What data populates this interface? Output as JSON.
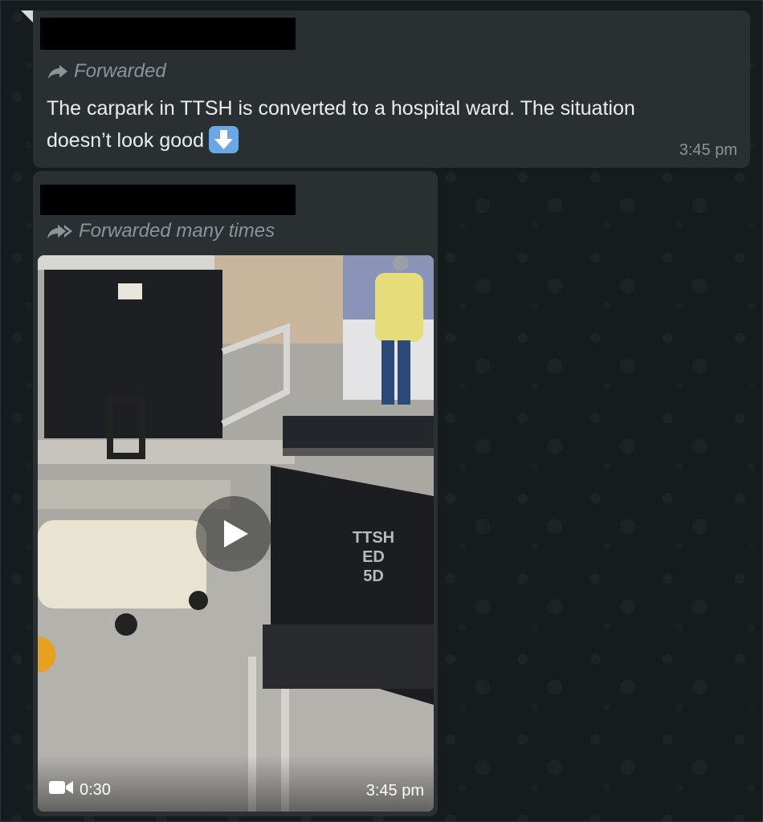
{
  "messages": [
    {
      "forward_label": "Forwarded",
      "text": "The carpark in TTSH is converted to a hospital ward. The situation doesn’t look good",
      "emoji": "down-arrow-emoji",
      "time": "3:45 pm"
    },
    {
      "forward_label": "Forwarded many times",
      "video": {
        "duration": "0:30",
        "time": "3:45 pm",
        "chair_label_lines": [
          "TTSH",
          "ED",
          "5D"
        ]
      }
    }
  ],
  "colors": {
    "background": "#161b1e",
    "bubble": "#2a2f32",
    "text": "#e9edef",
    "meta_text": "#8d9396",
    "emoji_blue": "#6aa7e6"
  },
  "icons": [
    "forward-icon",
    "forward-many-icon",
    "play-icon",
    "video-camera-icon",
    "down-arrow-emoji"
  ]
}
